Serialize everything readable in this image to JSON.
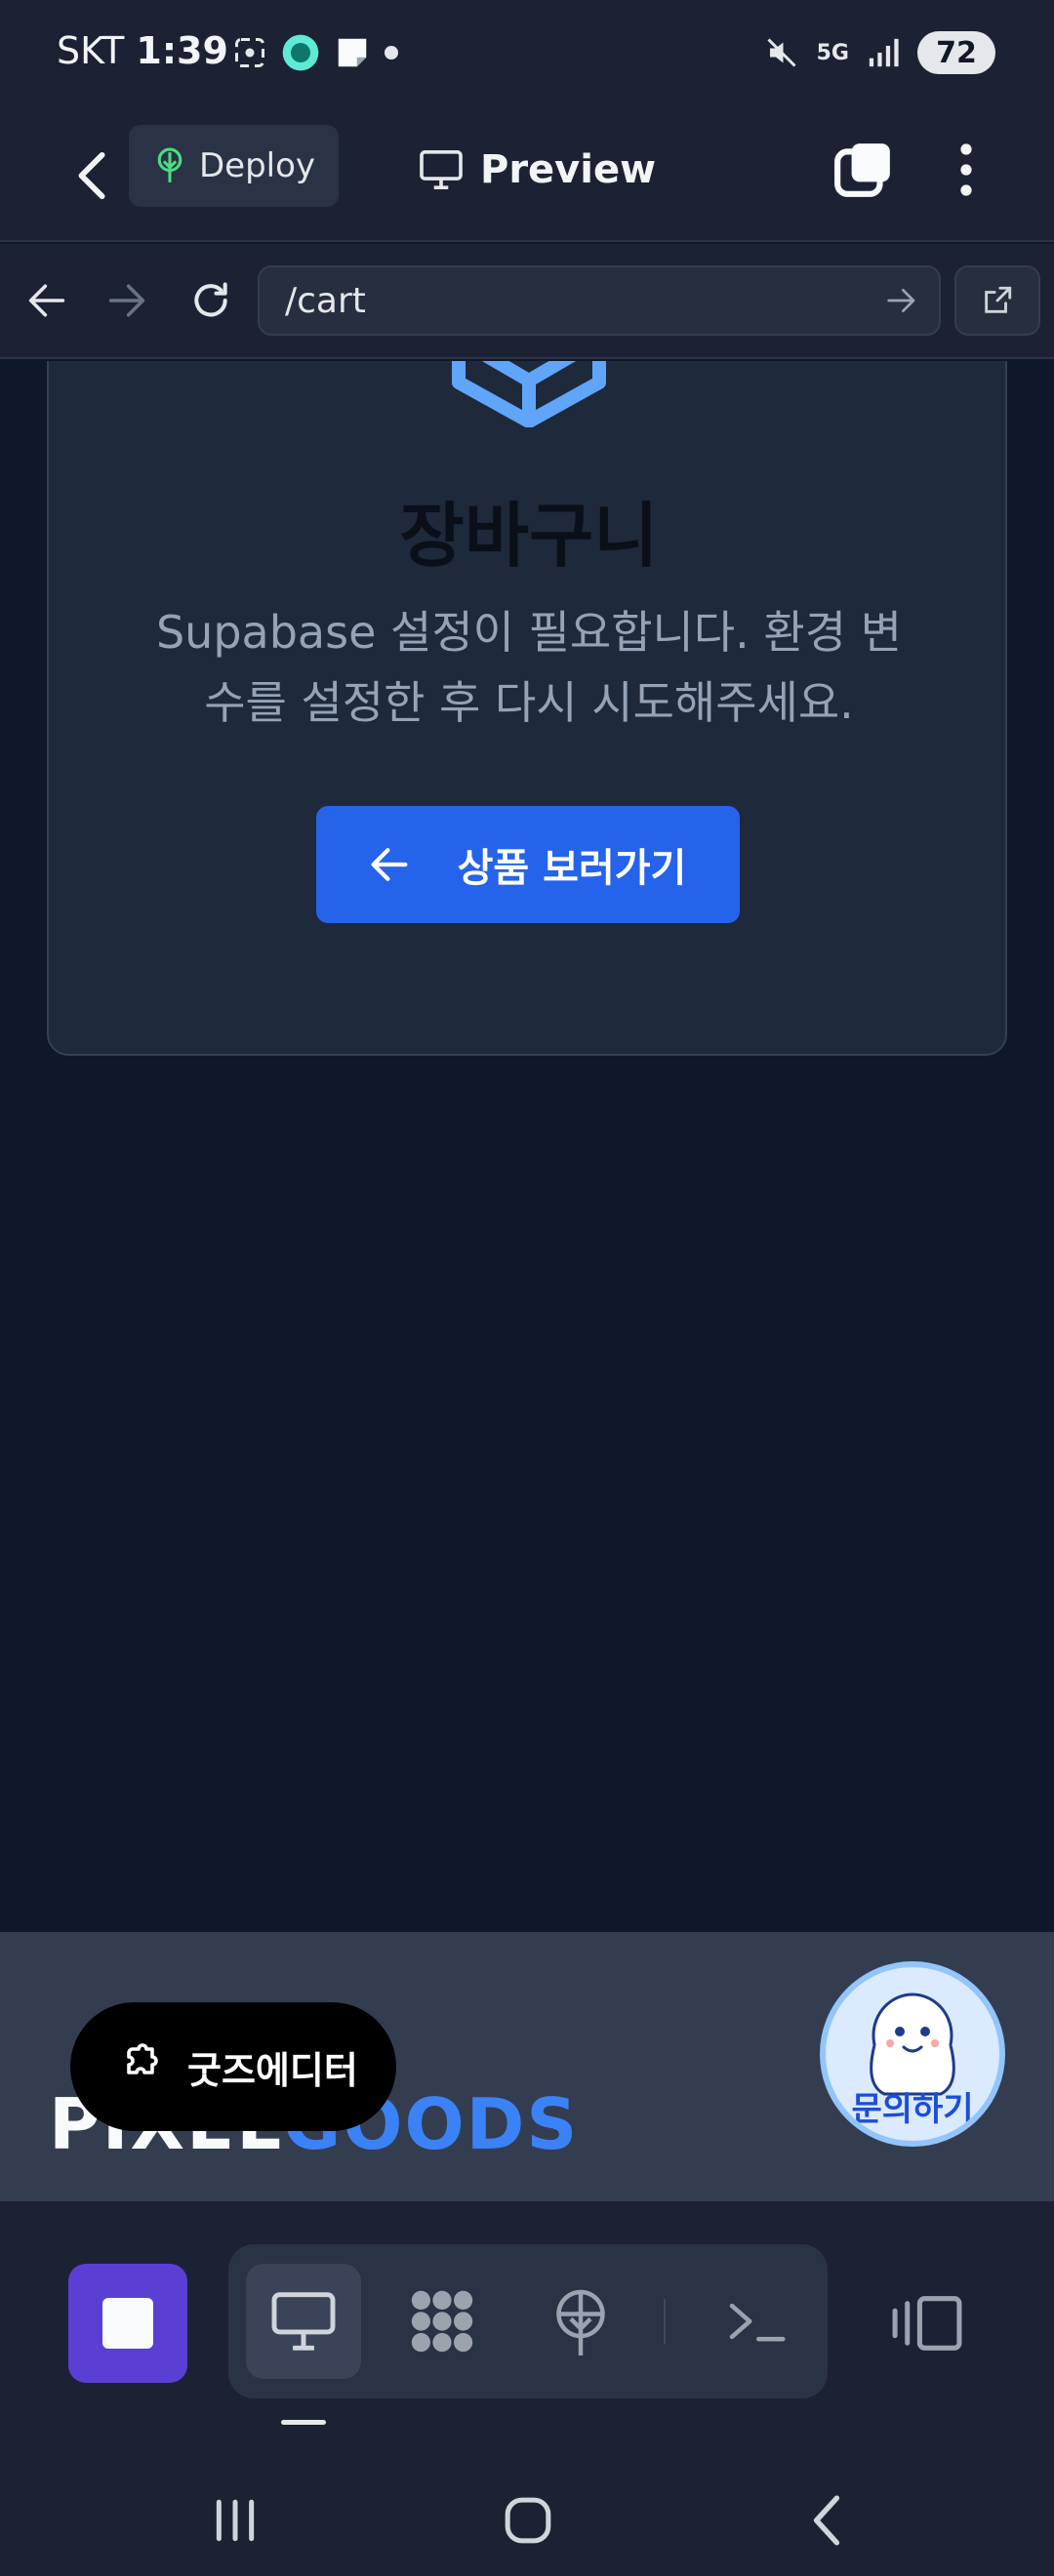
{
  "status_bar": {
    "carrier": "SKT",
    "time": "1:39",
    "network": "5G",
    "battery": "72"
  },
  "header": {
    "deploy_label": "Deploy",
    "preview_label": "Preview"
  },
  "url_bar": {
    "url": "/cart"
  },
  "cart": {
    "title": "장바구니",
    "description": "Supabase 설정이 필요합니다. 환경 변수를 설정한 후 다시 시도해주세요.",
    "back_button": "상품 보러가기"
  },
  "footer": {
    "brand_part1": "PIXEL",
    "brand_part2": "GOODS",
    "goods_editor_label": "굿즈에디터",
    "inquiry_label": "문의하기"
  },
  "colors": {
    "accent_blue": "#2563eb",
    "brand_blue": "#3b82f6",
    "stop_purple": "#5b3fd4",
    "deploy_green": "#4ade80"
  },
  "icons": {
    "header": [
      "back-arrow-icon",
      "deploy-tree-icon",
      "monitor-icon",
      "copy-icon",
      "more-vertical-icon"
    ],
    "url_bar": [
      "arrow-left-icon",
      "arrow-right-icon",
      "refresh-icon",
      "url-go-arrow-icon",
      "external-link-icon"
    ],
    "toolbar": [
      "stop-icon",
      "desktop-icon",
      "dots-grid-icon",
      "globe-antenna-icon",
      "terminal-icon",
      "panel-toggle-icon"
    ]
  }
}
